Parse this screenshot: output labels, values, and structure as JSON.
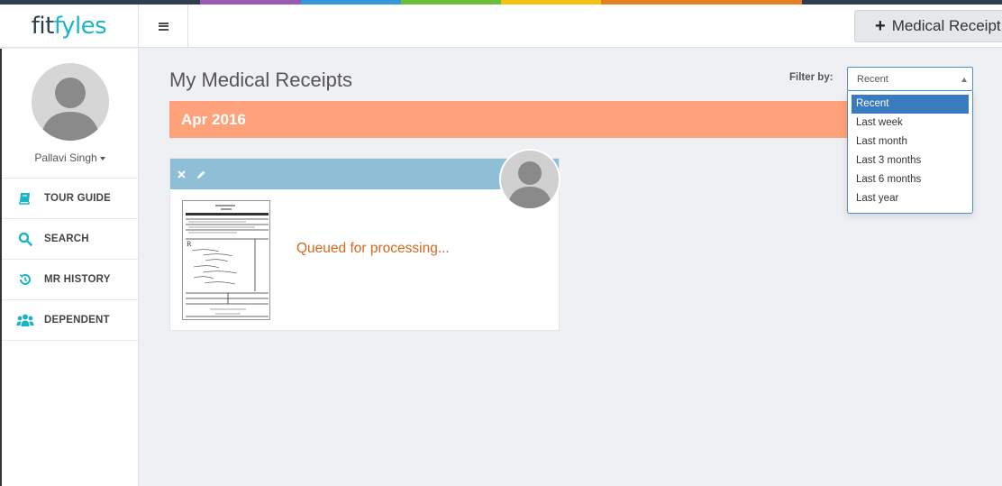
{
  "brand": {
    "logo_part1": "fit",
    "logo_part2": "fyles",
    "stripe_colors": [
      "#2c3e50",
      "#2c3e50",
      "#9b59b6",
      "#3498db",
      "#6cbf3a",
      "#f5c30f",
      "#e67e22",
      "#e67e22",
      "#2c3e50",
      "#2c3e50"
    ]
  },
  "header": {
    "menu_icon": "hamburger-icon",
    "add_button_icon": "plus-icon",
    "add_button_label": "Medical Receipt"
  },
  "sidebar": {
    "user_name": "Pallavi Singh",
    "nav": [
      {
        "label": "TOUR GUIDE",
        "icon": "book-icon"
      },
      {
        "label": "SEARCH",
        "icon": "search-icon"
      },
      {
        "label": "MR HISTORY",
        "icon": "history-icon"
      },
      {
        "label": "DEPENDENT",
        "icon": "users-icon"
      }
    ]
  },
  "main": {
    "title": "My Medical Receipts",
    "filter": {
      "label": "Filter by:",
      "selected": "Recent",
      "options": [
        "Recent",
        "Last week",
        "Last month",
        "Last 3 months",
        "Last 6 months",
        "Last year"
      ]
    },
    "groups": [
      {
        "month": "Apr 2016",
        "receipts": [
          {
            "status": "Queued for processing..."
          }
        ]
      }
    ]
  },
  "colors": {
    "accent": "#1bb5c4",
    "banner": "#ffa17a",
    "card_header": "#8fbfd6",
    "status_text": "#d2691e",
    "dropdown_selected": "#3a7abf"
  }
}
